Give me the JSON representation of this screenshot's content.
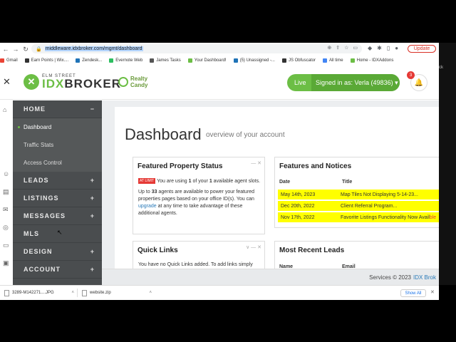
{
  "browser": {
    "url": "middleware.idxbroker.com/mgmt/dashboard",
    "update_label": "Update",
    "bookmarks": [
      {
        "label": "Gmail",
        "color": "#ea4335"
      },
      {
        "label": "Earn Points | Wix....",
        "color": "#333333"
      },
      {
        "label": "Zendesk...",
        "color": "#1f73b7"
      },
      {
        "label": "Evernote Web",
        "color": "#2dbe60"
      },
      {
        "label": "James Tasks",
        "color": "#555555"
      },
      {
        "label": "Your Dashboard!",
        "color": "#6cbe45"
      },
      {
        "label": "(5) Unassigned -...",
        "color": "#1f73b7"
      },
      {
        "label": "JS Obfuscator",
        "color": "#333333"
      },
      {
        "label": "All time",
        "color": "#4285f4"
      },
      {
        "label": "Home - IDXAddons",
        "color": "#6cbe45"
      }
    ]
  },
  "header": {
    "logo_small": "ELM STREET",
    "logo_idx": "IDX",
    "logo_broker": "BROKER",
    "partner_line1": "Realty",
    "partner_line2": "Candy",
    "live_label": "Live",
    "signed_in_label": "Signed in as: Verla (49836) ▾",
    "notification_count": "3"
  },
  "sidebar": {
    "home": "HOME",
    "home_sign": "−",
    "sub_items": [
      "Dashboard",
      "Traffic Stats",
      "Access Control"
    ],
    "sections": [
      {
        "label": "LEADS",
        "sign": "+"
      },
      {
        "label": "LISTINGS",
        "sign": "+"
      },
      {
        "label": "MESSAGES",
        "sign": "+"
      },
      {
        "label": "MLS",
        "sign": ""
      },
      {
        "label": "DESIGN",
        "sign": "+"
      },
      {
        "label": "ACCOUNT",
        "sign": "+"
      }
    ]
  },
  "main": {
    "title": "Dashboard",
    "subtitle": "overview of your account",
    "featured": {
      "title": "Featured Property Status",
      "badge": "AT LIMIT",
      "line1_pre": "You are using ",
      "line1_n1": "1",
      "line1_mid": " of your ",
      "line1_n2": "1",
      "line1_post": " available agent slots.",
      "line2_pre": "Up to ",
      "line2_n": "33",
      "line2_mid": " agents are available to power your featured properties pages based on your office ID(s). You can ",
      "line2_link": "upgrade",
      "line2_post": " at any time to take advantage of these additional agents."
    },
    "notices": {
      "title": "Features and Notices",
      "col_date": "Date",
      "col_title": "Title",
      "rows": [
        {
          "date": "May 14th, 2023",
          "title": "Map Tiles Not Displaying 5-14-23..."
        },
        {
          "date": "Dec 20th, 2022",
          "title": "Client Referral Program..."
        },
        {
          "date": "Nov 17th, 2022",
          "title": "Favorite Listings Functionality Now Avail",
          "trail": "ble"
        }
      ]
    },
    "quick_links": {
      "title": "Quick Links",
      "text": "You have no Quick Links added. To add links simply visit a page and click the \"Quick Link\" link"
    },
    "recent_leads": {
      "title": "Most Recent Leads",
      "col_name": "Name",
      "col_email": "Email"
    }
  },
  "footer": {
    "text": "Services © 2023",
    "brand": "IDX Brok"
  },
  "right_strip_text": "ck",
  "downloads": {
    "items": [
      "3289-M142271....JPG",
      "website.zip"
    ],
    "show_all": "Show All"
  }
}
